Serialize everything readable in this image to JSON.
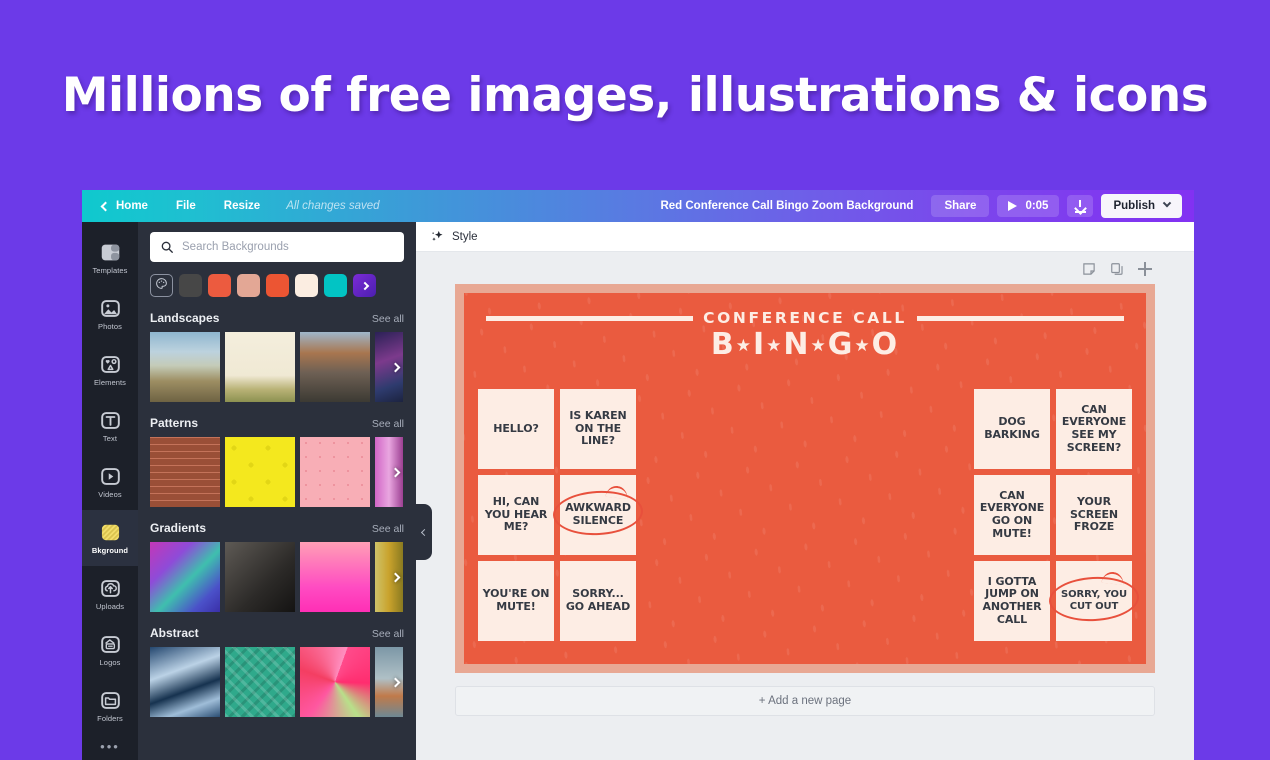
{
  "hero": {
    "title": "Millions of free images, illustrations & icons"
  },
  "colors": {
    "page_background": "#6C3AE8",
    "card_border": "#E8A894",
    "card_fill": "#EA5B3F",
    "cell_fill": "#FDEDE4",
    "rail_background": "#1C2029",
    "panel_background": "#2B303C",
    "mark_red": "#E8503C"
  },
  "topbar": {
    "home_label": "Home",
    "file_label": "File",
    "resize_label": "Resize",
    "saved_status": "All changes saved",
    "document_name": "Red Conference Call Bingo Zoom Background",
    "share_label": "Share",
    "duration": "0:05",
    "publish_label": "Publish",
    "icons": {
      "back": "chevron-left-icon",
      "play": "play-icon",
      "download": "download-icon",
      "publish_caret": "chevron-down-icon"
    }
  },
  "rail": {
    "items": [
      {
        "label": "Templates",
        "icon": "templates-icon",
        "active": false
      },
      {
        "label": "Photos",
        "icon": "photos-icon",
        "active": false
      },
      {
        "label": "Elements",
        "icon": "elements-icon",
        "active": false
      },
      {
        "label": "Text",
        "icon": "text-icon",
        "active": false
      },
      {
        "label": "Videos",
        "icon": "videos-icon",
        "active": false
      },
      {
        "label": "Bkground",
        "icon": "background-icon",
        "active": true
      },
      {
        "label": "Uploads",
        "icon": "uploads-icon",
        "active": false
      },
      {
        "label": "Logos",
        "icon": "logos-icon",
        "active": false
      },
      {
        "label": "Folders",
        "icon": "folders-icon",
        "active": false
      }
    ],
    "more_label": "•••"
  },
  "panel": {
    "search": {
      "placeholder": "Search Backgrounds",
      "value": "",
      "icon": "search-icon"
    },
    "swatches": [
      {
        "name": "color-picker",
        "color": ""
      },
      {
        "name": "swatch-dark-gray",
        "color": "#474747"
      },
      {
        "name": "swatch-red-orange",
        "color": "#EC5B3F"
      },
      {
        "name": "swatch-salmon",
        "color": "#E3A795"
      },
      {
        "name": "swatch-orange-red",
        "color": "#EC5533"
      },
      {
        "name": "swatch-cream",
        "color": "#FBEDE1"
      },
      {
        "name": "swatch-teal",
        "color": "#02C4C4"
      },
      {
        "name": "swatch-purple",
        "color": "#6A22C9"
      }
    ],
    "sections": [
      {
        "title": "Landscapes",
        "see_all": "See all",
        "thumbs": [
          "desert-horizon",
          "pale-field",
          "rocky-mountain",
          "dark-abstract"
        ]
      },
      {
        "title": "Patterns",
        "see_all": "See all",
        "thumbs": [
          "brick-wall",
          "yellow-lemon",
          "pink-dots",
          "magenta-gradient"
        ]
      },
      {
        "title": "Gradients",
        "see_all": "See all",
        "thumbs": [
          "violet-teal-poly",
          "dark-charcoal",
          "pink-magenta",
          "gold-olive"
        ]
      },
      {
        "title": "Abstract",
        "see_all": "See all",
        "thumbs": [
          "blue-ink",
          "green-grid",
          "pink-swirl",
          "muted-blue"
        ]
      }
    ],
    "collapse_icon": "chevron-left-icon"
  },
  "editor": {
    "style_label": "Style",
    "style_icon": "sparkle-icon",
    "page_tools": [
      {
        "name": "notes-icon"
      },
      {
        "name": "duplicate-page-icon"
      },
      {
        "name": "add-page-icon"
      }
    ],
    "add_page_label": "+ Add a new page"
  },
  "bingo": {
    "eyebrow": "CONFERENCE CALL",
    "title_letters": [
      "B",
      "I",
      "N",
      "G",
      "O"
    ],
    "title_separator": "★",
    "left_cells": [
      {
        "text": "HELLO?",
        "marked": false,
        "small": false
      },
      {
        "text": "IS KAREN ON THE LINE?",
        "marked": false,
        "small": false
      },
      {
        "text": "HI, CAN YOU HEAR ME?",
        "marked": false,
        "small": false
      },
      {
        "text": "AWKWARD SILENCE",
        "marked": true,
        "small": false
      },
      {
        "text": "YOU'RE ON MUTE!",
        "marked": false,
        "small": false
      },
      {
        "text": "SORRY... GO AHEAD",
        "marked": false,
        "small": false
      }
    ],
    "right_cells": [
      {
        "text": "DOG BARKING",
        "marked": false,
        "small": false
      },
      {
        "text": "CAN EVERYONE SEE MY SCREEN?",
        "marked": false,
        "small": false
      },
      {
        "text": "CAN EVERYONE GO ON MUTE!",
        "marked": false,
        "small": false
      },
      {
        "text": "YOUR SCREEN FROZE",
        "marked": false,
        "small": false
      },
      {
        "text": "I GOTTA JUMP ON ANOTHER CALL",
        "marked": false,
        "small": false
      },
      {
        "text": "SORRY, YOU CUT OUT",
        "marked": true,
        "small": true
      }
    ]
  }
}
